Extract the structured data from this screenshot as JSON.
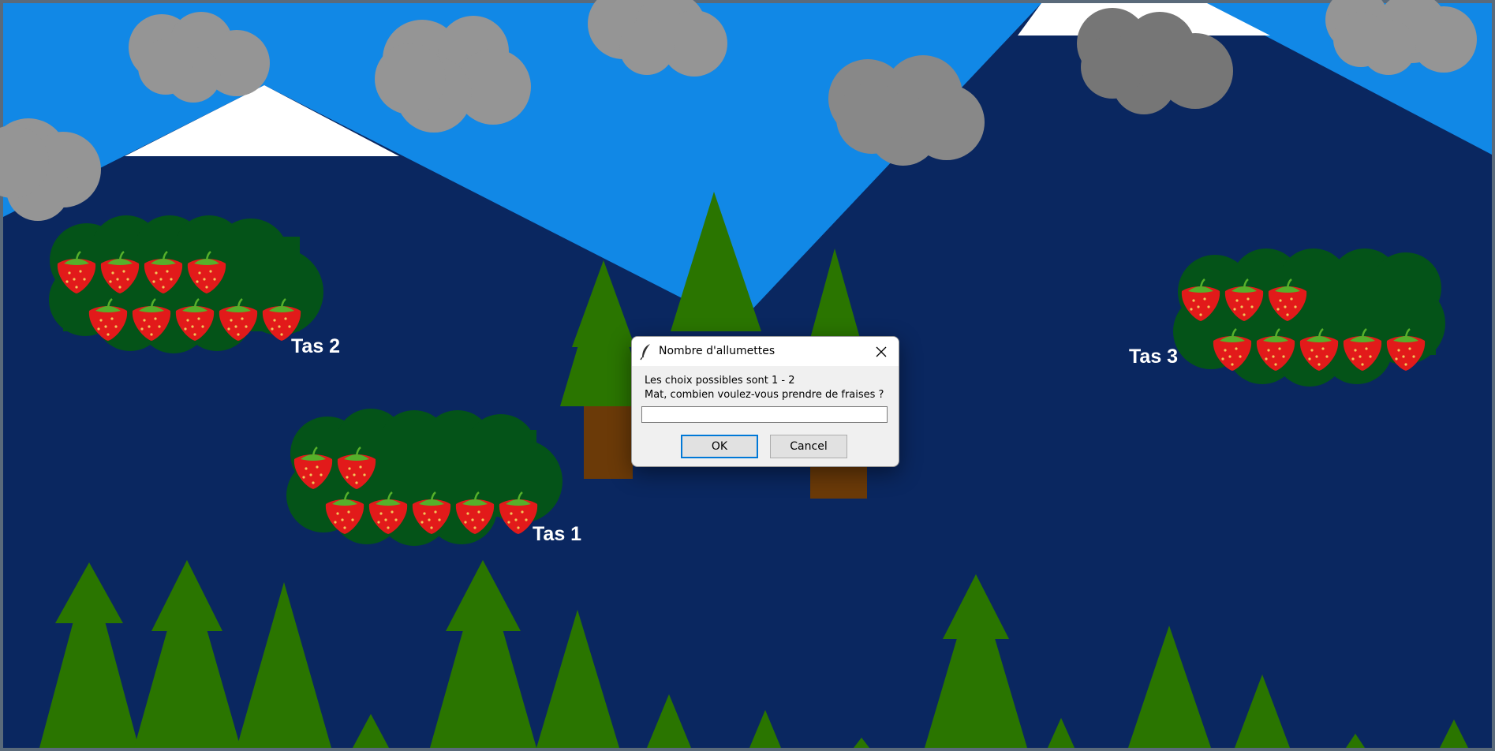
{
  "colors": {
    "sky": "#1188e6",
    "mountain": "#0a2760",
    "snow": "#ffffff",
    "cloud": "#8a8a8a",
    "bush": "#045318",
    "tree": "#2a7500",
    "trunk": "#6b3a08",
    "strawberry": "#e21a1a",
    "leaf": "#56b02a"
  },
  "piles": [
    {
      "label": "Tas 2",
      "count": 9
    },
    {
      "label": "Tas 1",
      "count": 7
    },
    {
      "label": "Tas 3",
      "count": 8
    }
  ],
  "dialog": {
    "icon": "feather-icon",
    "title": "Nombre d'allumettes",
    "line1": "Les choix possibles sont 1 - 2",
    "line2": "Mat, combien voulez-vous prendre de fraises ?",
    "input_value": "",
    "ok_label": "OK",
    "cancel_label": "Cancel"
  }
}
